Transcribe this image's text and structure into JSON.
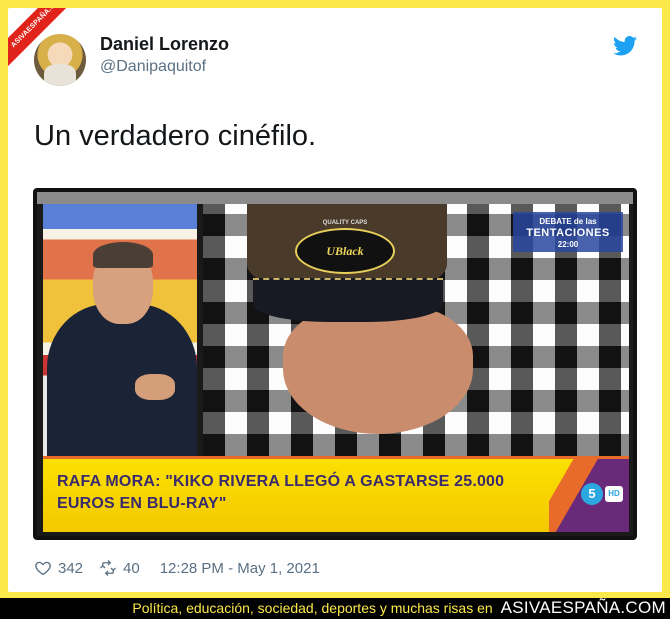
{
  "watermark": {
    "ribbon": "ASIVAESPAÑA.COM"
  },
  "author": {
    "name": "Daniel Lorenzo",
    "handle": "@Danipaquitof"
  },
  "tweet": {
    "text": "Un verdadero cinéfilo."
  },
  "photo": {
    "lower_third": "RAFA MORA: \"KIKO RIVERA LLEGÓ A GASTARSE 25.000 EUROS EN BLU-RAY\"",
    "cap_logo": "UBlack",
    "cap_top": "QUALITY CAPS",
    "debate_small": "DEBATE de las",
    "debate_big": "TENTACIONES",
    "debate_time": "22:00",
    "channel": "5",
    "hd": "HD"
  },
  "stats": {
    "likes": "342",
    "retweets": "40",
    "timestamp": "12:28 PM - May 1, 2021"
  },
  "footer": {
    "tagline": "Política, educación, sociedad, deportes y muchas risas en",
    "brand": "ASIVAESPAÑA.COM"
  },
  "colors": {
    "background": "#fbe94a",
    "twitter_blue": "#1da1f2",
    "ribbon_red": "#e0241b",
    "meta_gray": "#5b7083"
  },
  "icons": [
    "twitter-bird-icon",
    "heart-icon",
    "retweet-icon"
  ]
}
